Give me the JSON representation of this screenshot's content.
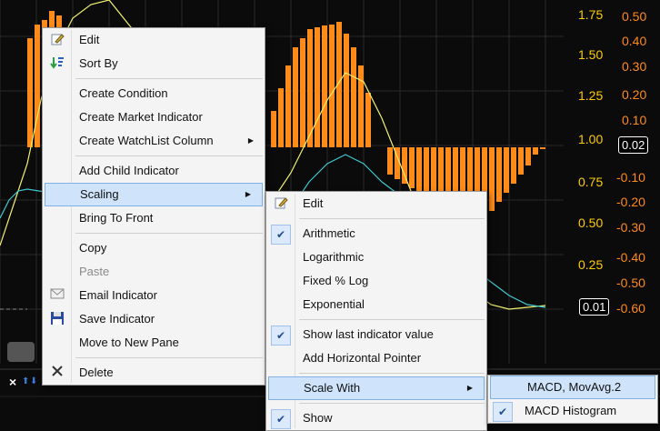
{
  "colors": {
    "bar": "#ff8c1a",
    "axis_left": "#ffcc00",
    "axis_right": "#ff8a1a",
    "line1": "#f0f070",
    "line2": "#40c8d0"
  },
  "axis_left": {
    "labels": [
      "1.75",
      "1.50",
      "1.25",
      "1.00",
      "0.75",
      "0.50",
      "0.25"
    ]
  },
  "axis_right": {
    "labels": [
      "0.50",
      "0.40",
      "0.30",
      "0.20",
      "0.10",
      "-0.10",
      "-0.20",
      "-0.30",
      "-0.40",
      "-0.50",
      "-0.60"
    ],
    "current_value": "0.02"
  },
  "axis_left_marker": "0.01",
  "context_menu": {
    "items": [
      {
        "label": "Edit",
        "icon": "edit-icon"
      },
      {
        "label": "Sort By",
        "icon": "sort-icon"
      },
      {
        "label": "Create Condition"
      },
      {
        "label": "Create Market Indicator"
      },
      {
        "label": "Create WatchList Column",
        "submenu": true
      },
      {
        "label": "Add Child Indicator"
      },
      {
        "label": "Scaling",
        "submenu": true,
        "highlighted": true
      },
      {
        "label": "Bring To Front"
      },
      {
        "label": "Copy"
      },
      {
        "label": "Paste",
        "disabled": true
      },
      {
        "label": "Email Indicator",
        "icon": "email-icon"
      },
      {
        "label": "Save Indicator",
        "icon": "save-icon"
      },
      {
        "label": "Move to New Pane"
      },
      {
        "label": "Delete",
        "icon": "delete-icon"
      }
    ]
  },
  "scaling_menu": {
    "items": [
      {
        "label": "Edit",
        "icon": "edit-icon"
      },
      {
        "label": "Arithmetic",
        "checked": true
      },
      {
        "label": "Logarithmic"
      },
      {
        "label": "Fixed % Log"
      },
      {
        "label": "Exponential"
      },
      {
        "label": "Show last indicator value",
        "checked": true
      },
      {
        "label": "Add Horizontal Pointer"
      },
      {
        "label": "Scale With",
        "submenu": true,
        "highlighted": true
      },
      {
        "label": "Show",
        "checked": true
      }
    ]
  },
  "scale_with_menu": {
    "items": [
      {
        "label": "MACD, MovAvg.2",
        "highlighted": true
      },
      {
        "label": "MACD Histogram",
        "checked": true
      }
    ]
  },
  "bottom_controls": {
    "close_glyph": "×",
    "arrow_up": "⬆",
    "arrow_down": "⬇"
  }
}
